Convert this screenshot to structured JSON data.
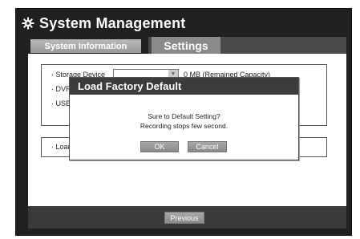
{
  "window": {
    "title": "System Management",
    "icon": "gear-icon"
  },
  "tabs": [
    {
      "label": "System Information",
      "active": false
    },
    {
      "label": "Settings",
      "active": true
    }
  ],
  "settings": {
    "storage_label": "· Storage Device",
    "storage_capacity": "0 MB (Remained Capacity)",
    "dvr_label": "· DVR",
    "usb_label": "· USB",
    "load_label": "· Load"
  },
  "dialog": {
    "title": "Load Factory Default",
    "message_line1": "Sure to Default Setting?",
    "message_line2": "Recording stops few second.",
    "ok_label": "OK",
    "cancel_label": "Cancel"
  },
  "footer": {
    "previous_label": "Previous"
  },
  "colors": {
    "frame": "#202020",
    "tab_active": "#8a8a8a",
    "dialog_title": "#3c3c3c",
    "button": "#999999"
  }
}
